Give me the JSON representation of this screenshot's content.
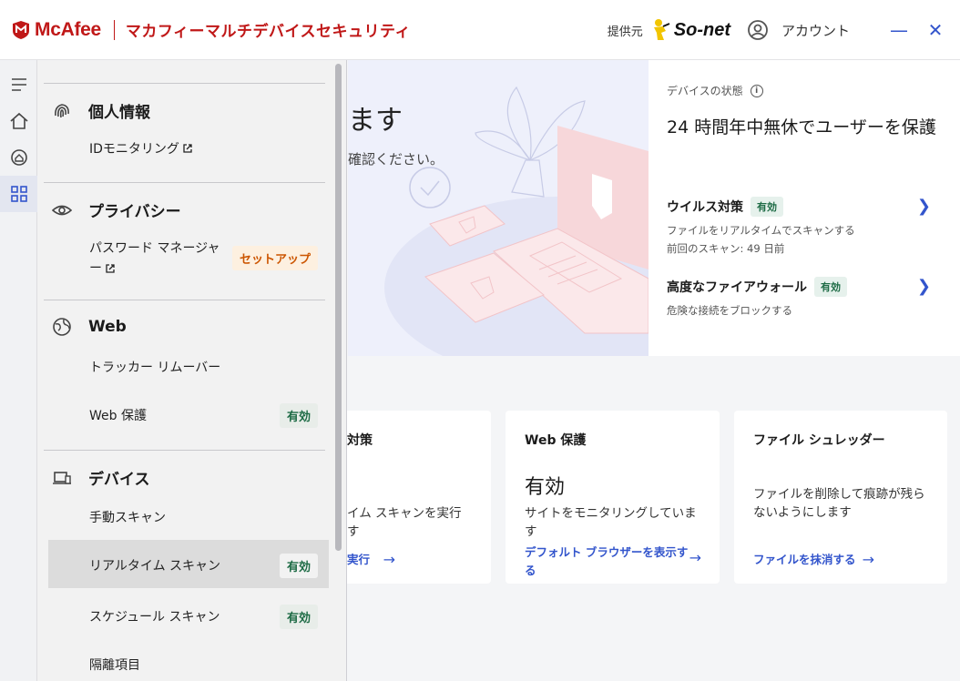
{
  "titlebar": {
    "brand": "McAfee",
    "product": "マカフィーマルチデバイスセキュリティ",
    "provider_label": "提供元",
    "partner": "So-net",
    "account_label": "アカウント",
    "minimize_glyph": "—",
    "close_glyph": "✕"
  },
  "rail": {
    "items": [
      "menu-icon",
      "home-icon",
      "protection-icon",
      "apps-grid-icon"
    ],
    "active": "apps-grid-icon"
  },
  "hero": {
    "title_partial": "ます",
    "subtitle_partial": "確認ください。"
  },
  "device_status": {
    "label": "デバイスの状態",
    "headline": "24 時間年中無休でユーザーを保護",
    "rows": [
      {
        "title": "ウイルス対策",
        "badge": "有効",
        "desc1": "ファイルをリアルタイムでスキャンする",
        "desc2": "前回のスキャン: 49 日前"
      },
      {
        "title": "高度なファイアウォール",
        "badge": "有効",
        "desc1": "危険な接続をブロックする"
      }
    ]
  },
  "cards": [
    {
      "title": "対策",
      "desc": "イム スキャンを実行\nす",
      "link": "実行"
    },
    {
      "title": "Web 保護",
      "status": "有効",
      "desc": "サイトをモニタリングしています",
      "link": "デフォルト ブラウザーを表示する"
    },
    {
      "title": "ファイル シュレッダー",
      "desc": "ファイルを削除して痕跡が残らないようにします",
      "link": "ファイルを抹消する"
    }
  ],
  "menu": {
    "sections": [
      {
        "title": "個人情報",
        "icon": "fingerprint-icon",
        "items": [
          {
            "label": "IDモニタリング",
            "external": true
          }
        ]
      },
      {
        "title": "プライバシー",
        "icon": "eye-icon",
        "items": [
          {
            "label": "パスワード マネージャー",
            "external": true,
            "badge": "セットアップ"
          }
        ]
      },
      {
        "title": "Web",
        "icon": "globe-icon",
        "items": [
          {
            "label": "トラッカー リムーバー"
          },
          {
            "label": "Web 保護",
            "badge": "有効"
          }
        ]
      },
      {
        "title": "デバイス",
        "icon": "laptop-icon",
        "items": [
          {
            "label": "手動スキャン"
          },
          {
            "label": "リアルタイム スキャン",
            "badge": "有効",
            "selected": true
          },
          {
            "label": "スケジュール スキャン",
            "badge": "有効"
          },
          {
            "label": "隔離項目"
          }
        ]
      }
    ],
    "password_line1": "パスワード マネージャ",
    "password_line2": "ー"
  },
  "colors": {
    "brand_red": "#c01818",
    "accent_blue": "#3355cc",
    "enabled_green": "#1d6b45",
    "setup_orange": "#cc5500"
  }
}
